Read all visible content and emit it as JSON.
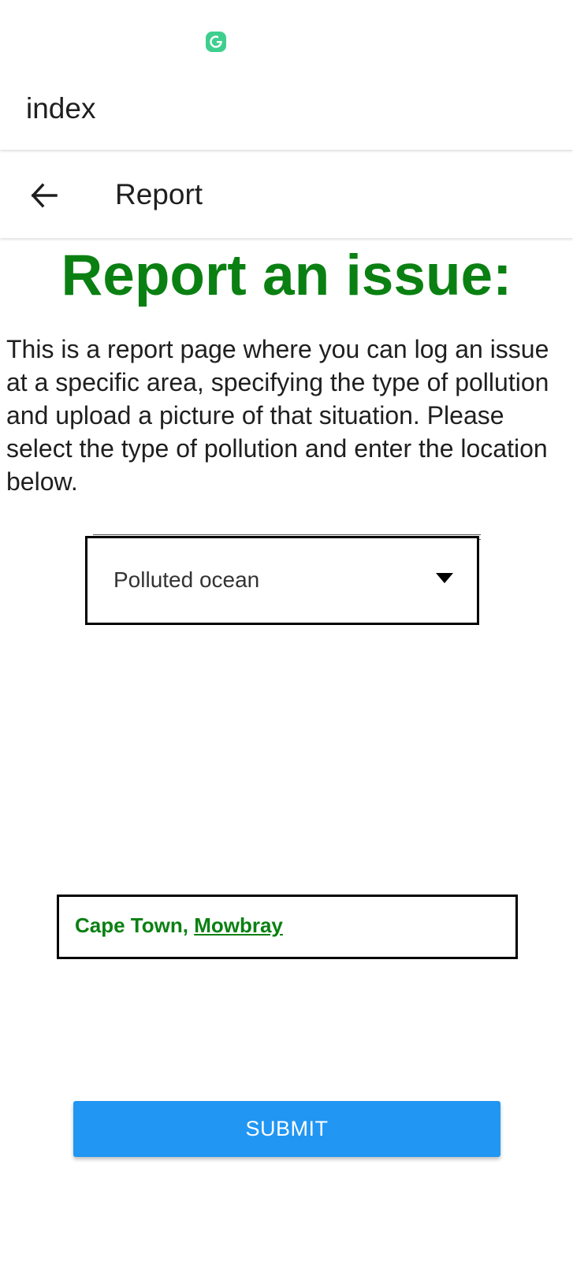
{
  "status_bar": {
    "app_icon": "grammarly-style-app-icon"
  },
  "app_bar": {
    "title": "index"
  },
  "report_header": {
    "back_icon": "arrow-left-icon",
    "title": "Report"
  },
  "main": {
    "heading": "Report an issue:",
    "description": "This is a report page where you can log an issue at a specific area, specifying the type of pollution and upload a picture of that situation. Please select the type of pollution and enter the location below.",
    "pollution_type_select": {
      "selected_value": "Polluted ocean",
      "arrow_icon": "caret-down-icon"
    },
    "location_field": {
      "value_part1": "Cape Town, ",
      "value_part2": "Mowbray"
    },
    "submit_label": "SUBMIT"
  },
  "colors": {
    "heading_green": "#0a8012",
    "submit_blue": "#2196f3",
    "app_icon_green": "#3ecf8e"
  }
}
